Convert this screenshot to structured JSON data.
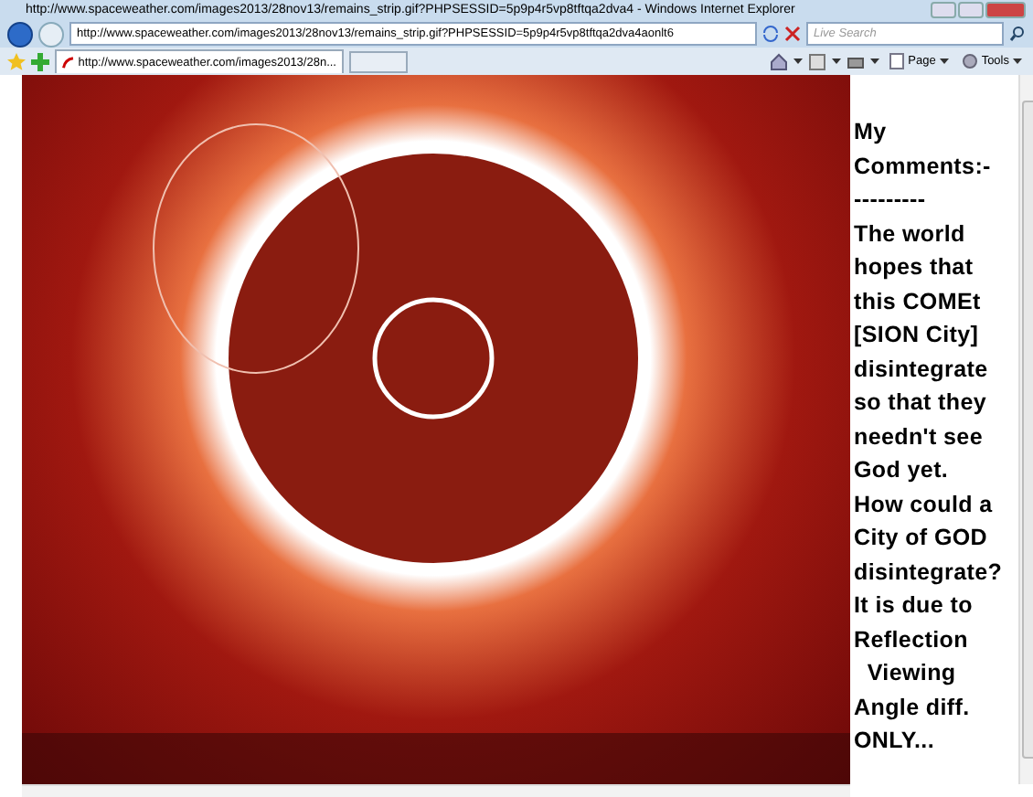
{
  "window": {
    "title": "http://www.spaceweather.com/images2013/28nov13/remains_strip.gif?PHPSESSID=5p9p4r5vp8tftqa2dva4 - Windows Internet Explorer"
  },
  "address_bar": {
    "value": "http://www.spaceweather.com/images2013/28nov13/remains_strip.gif?PHPSESSID=5p9p4r5vp8tftqa2dva4aonlt6"
  },
  "search": {
    "placeholder": "Live Search"
  },
  "tabs": [
    {
      "label": "http://www.spaceweather.com/images2013/28n...",
      "selected": true
    }
  ],
  "toolbar": [
    {
      "label": "Page"
    },
    {
      "label": "Tools"
    }
  ],
  "comments": "My\nComments:-\n---------\nThe world\nhopes that\nthis COMEt\n[SION City]\ndisintegrate\nso that they\nneedn't see\nGod yet.\nHow could a\nCity of GOD\ndisintegrate?\nIt is due to\nReflection\n  Viewing\nAngle diff.\nONLY..."
}
